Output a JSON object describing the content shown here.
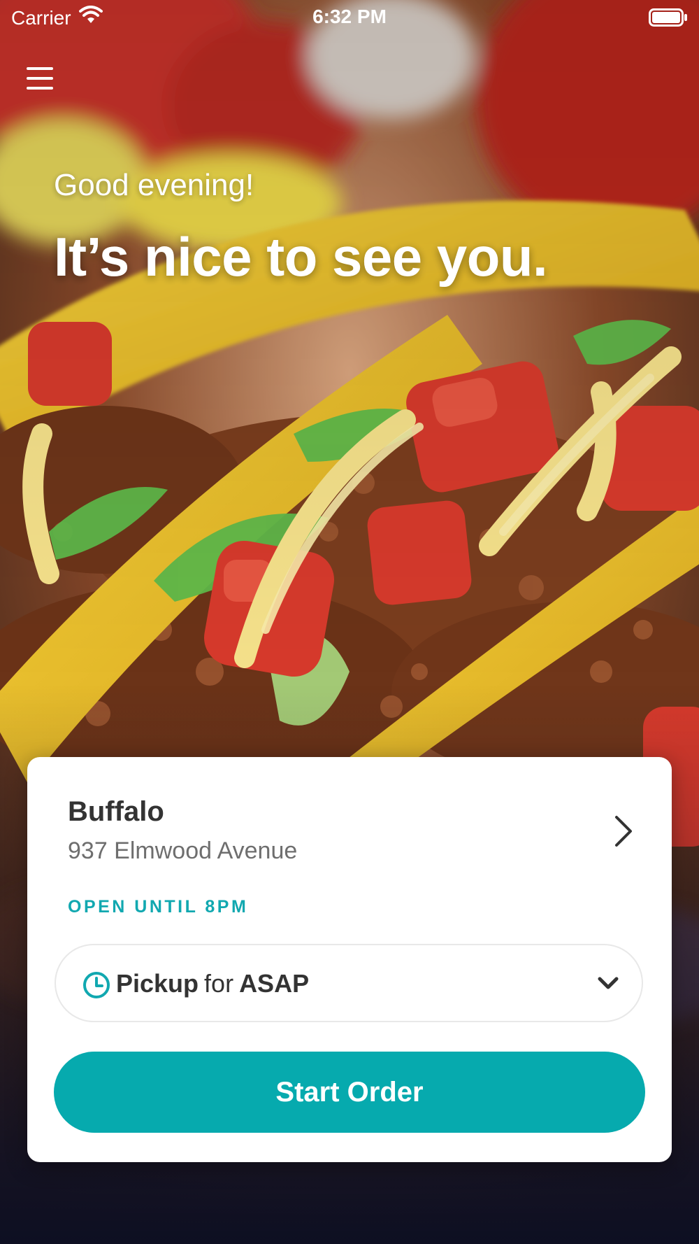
{
  "status_bar": {
    "carrier": "Carrier",
    "time": "6:32 PM"
  },
  "icons": {
    "menu": "hamburger-menu-icon",
    "wifi": "wifi-icon",
    "battery": "battery-icon",
    "location_chevron": "chevron-right-icon",
    "clock": "clock-icon",
    "dropdown": "chevron-down-icon"
  },
  "hero": {
    "greeting": "Good evening!",
    "headline": "It’s nice to see you."
  },
  "location": {
    "name": "Buffalo",
    "address": "937 Elmwood Avenue",
    "status": "OPEN UNTIL 8PM"
  },
  "order_type": {
    "method": "Pickup",
    "connector": "for",
    "time": "ASAP"
  },
  "actions": {
    "start_order_label": "Start Order"
  },
  "colors": {
    "accent": "#06aaae",
    "open_status": "#11a8b0",
    "card_background": "#ffffff"
  }
}
